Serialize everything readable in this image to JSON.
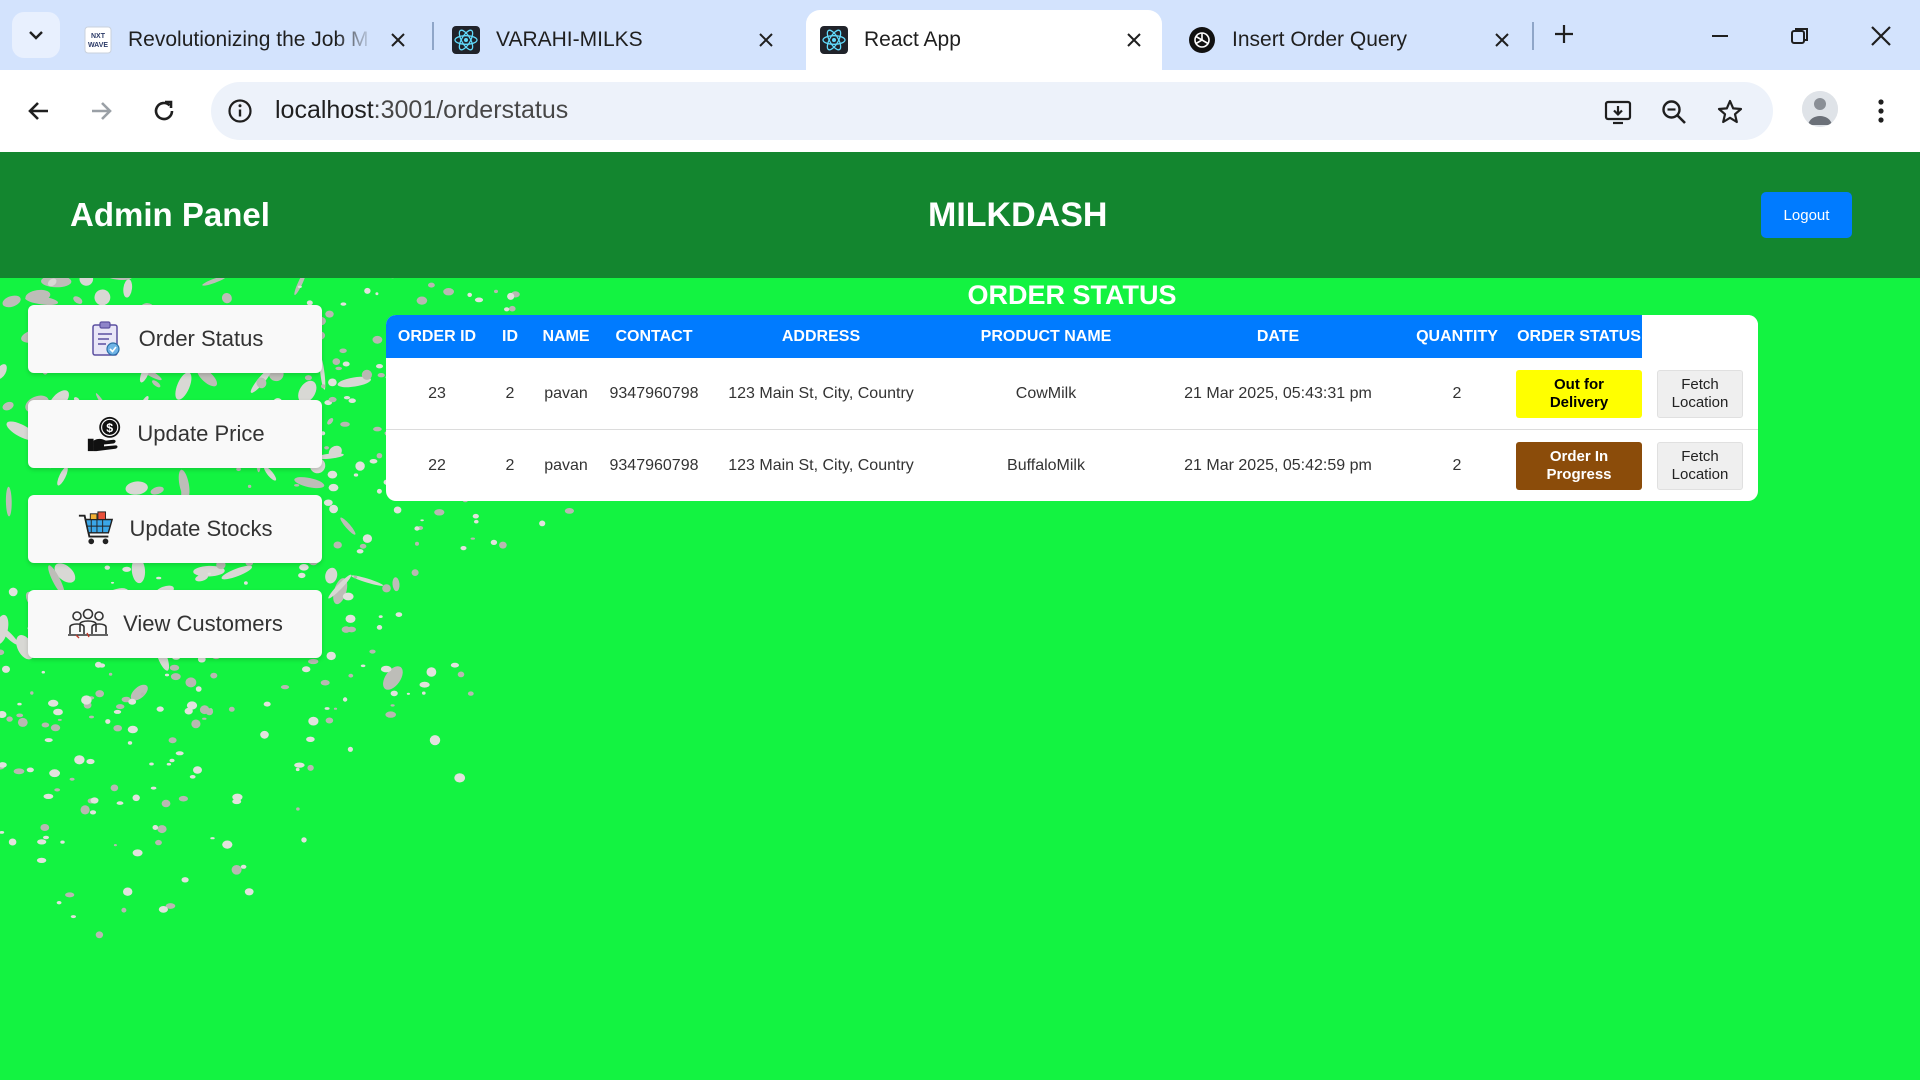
{
  "browser": {
    "tabs": [
      {
        "title": "Revolutionizing the Job M",
        "favicon": "nxtwave-icon",
        "active": false
      },
      {
        "title": "VARAHI-MILKS",
        "favicon": "react-icon",
        "active": false
      },
      {
        "title": "React App",
        "favicon": "react-icon",
        "active": true
      },
      {
        "title": "Insert Order Query",
        "favicon": "chatgpt-icon",
        "active": false
      }
    ],
    "favicon_text": {
      "nxtwave_line1": "NXT",
      "nxtwave_line2": "WAVE"
    },
    "url_host": "localhost",
    "url_path": ":3001/orderstatus"
  },
  "header": {
    "brand": "Admin Panel",
    "title": "MILKDASH",
    "logout_label": "Logout",
    "color": "#13862f"
  },
  "sidebar": {
    "items": [
      {
        "label": "Order Status",
        "icon": "clipboard-icon"
      },
      {
        "label": "Update Price",
        "icon": "price-hand-icon"
      },
      {
        "label": "Update Stocks",
        "icon": "cart-icon"
      },
      {
        "label": "View Customers",
        "icon": "customers-icon"
      }
    ]
  },
  "orders": {
    "title": "ORDER STATUS",
    "columns": [
      "ORDER ID",
      "ID",
      "NAME",
      "CONTACT",
      "ADDRESS",
      "PRODUCT NAME",
      "DATE",
      "QUANTITY",
      "ORDER STATUS"
    ],
    "rows": [
      {
        "order_id": "23",
        "id": "2",
        "name": "pavan",
        "contact": "9347960798",
        "address": "123 Main St, City, Country",
        "product": "CowMilk",
        "date": "21 Mar 2025, 05:43:31 pm",
        "quantity": "2",
        "status_line1": "Out for",
        "status_line2": "Delivery",
        "status_bg": "#ffff00",
        "status_fg": "#000000",
        "fetch_line1": "Fetch",
        "fetch_line2": "Location"
      },
      {
        "order_id": "22",
        "id": "2",
        "name": "pavan",
        "contact": "9347960798",
        "address": "123 Main St, City, Country",
        "product": "BuffaloMilk",
        "date": "21 Mar 2025, 05:42:59 pm",
        "quantity": "2",
        "status_line1": "Order In",
        "status_line2": "Progress",
        "status_bg": "#8b4c0a",
        "status_fg": "#ffffff",
        "fetch_line1": "Fetch",
        "fetch_line2": "Location"
      }
    ]
  },
  "colors": {
    "page_bg": "#13f341",
    "table_header": "#007bff",
    "logout": "#007bff"
  }
}
